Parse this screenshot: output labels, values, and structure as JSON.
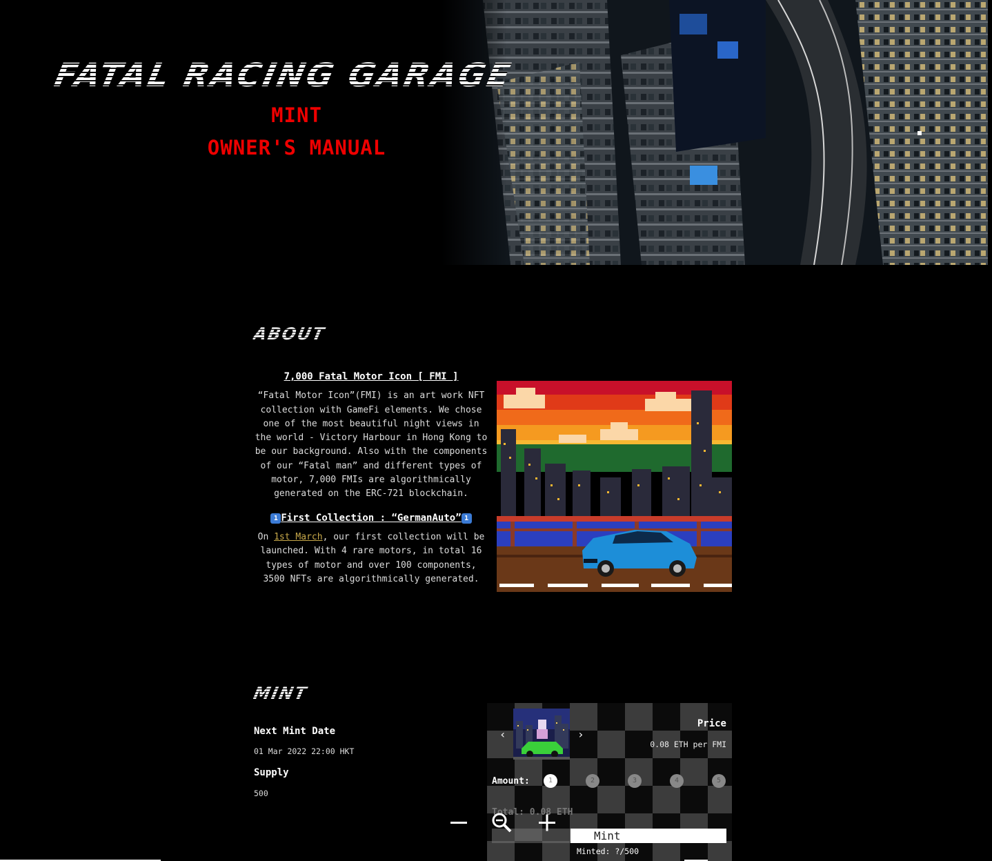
{
  "hero": {
    "title": "FATAL RACING GARAGE",
    "links": {
      "mint": "MINT",
      "owners_manual": "OWNER'S MANUAL"
    }
  },
  "about": {
    "heading": "ABOUT",
    "subtitle": "7,000 Fatal Motor Icon [ FMI ]",
    "paragraph": "“Fatal Motor Icon”(FMI) is an art work NFT collection with GameFi elements. We chose one of the most beautiful night views in the world - Victory Harbour in Hong Kong to be our background. Also with the components of our “Fatal man” and different types of motor, 7,000 FMIs are algorithmically generated on the ERC-721 blockchain.",
    "collection_title": "First Collection : “GermanAuto”",
    "collection_keycap": "1",
    "collection_prefix": "On ",
    "collection_date": "1st March",
    "collection_rest": ", our first collection will be launched. With 4 rare motors, in total 16 types of motor and over 100 components, 3500 NFTs are algorithmically generated."
  },
  "mint": {
    "heading": "MINT",
    "next_mint_label": "Next Mint Date",
    "next_mint_value": "01 Mar 2022 22:00 HKT",
    "supply_label": "Supply",
    "supply_value": "500",
    "panel": {
      "price_label": "Price",
      "price_value": "0.08 ETH per FMI",
      "amount_label": "Amount:",
      "amount_options": [
        "1",
        "2",
        "3",
        "4",
        "5"
      ],
      "selected_amount": "1",
      "total": "Total: 0.08 ETH",
      "mint_button": "Mint",
      "minted": "Minted: ?/500",
      "prev_arrow": "‹",
      "next_arrow": "›"
    }
  },
  "zoom": {
    "out_icon": "minus-icon",
    "reset_icon": "zoom-magnifier-icon",
    "in_icon": "plus-icon"
  },
  "colors": {
    "accent_red": "#e00000",
    "link_gold": "#c8a94a",
    "background": "#000000",
    "panel_check": "#3c3c3c"
  }
}
